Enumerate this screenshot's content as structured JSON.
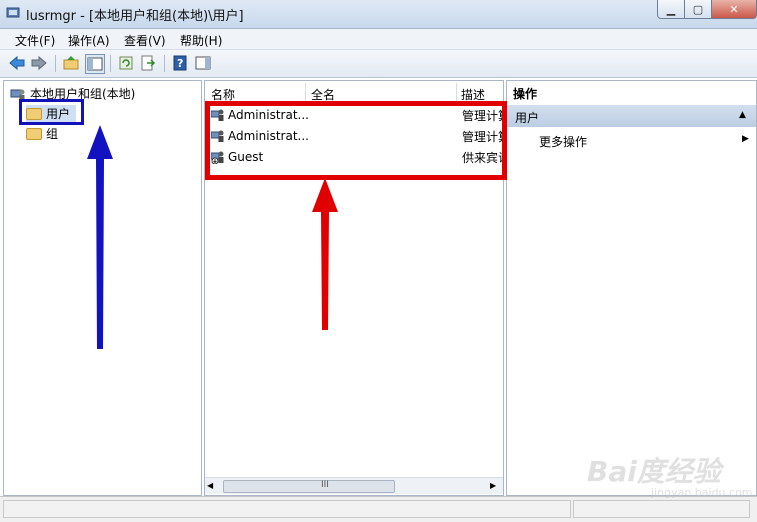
{
  "window": {
    "title": "lusrmgr - [本地用户和组(本地)\\用户]",
    "min_glyph": "▭",
    "max_glyph": "▢",
    "close_glyph": "✕"
  },
  "menu": {
    "file": "文件(F)",
    "action": "操作(A)",
    "view": "查看(V)",
    "help": "帮助(H)"
  },
  "toolbar": {
    "icons": [
      "back-arrow-icon",
      "forward-arrow-icon",
      "up-folder-icon",
      "show-hide-tree-icon",
      "refresh-icon",
      "export-list-icon",
      "help-icon",
      "show-action-pane-icon"
    ]
  },
  "tree": {
    "root": "本地用户和组(本地)",
    "users": "用户",
    "groups": "组"
  },
  "list": {
    "columns": [
      "名称",
      "全名",
      "描述"
    ],
    "rows": [
      {
        "name": "Administrat...",
        "fullname": "",
        "description": "管理计算"
      },
      {
        "name": "Administrat...",
        "fullname": "",
        "description": "管理计算"
      },
      {
        "name": "Guest",
        "fullname": "",
        "description": "供来宾访"
      }
    ],
    "scroll_grip": "III"
  },
  "actions": {
    "title": "操作",
    "section": "用户",
    "more": "更多操作"
  },
  "watermark": {
    "text": "Bai度经验",
    "url": "jingyan.baidu.com"
  },
  "colors": {
    "annotation_blue": "#1212b8",
    "annotation_red": "#e00000",
    "selection": "#cfe0f5"
  }
}
